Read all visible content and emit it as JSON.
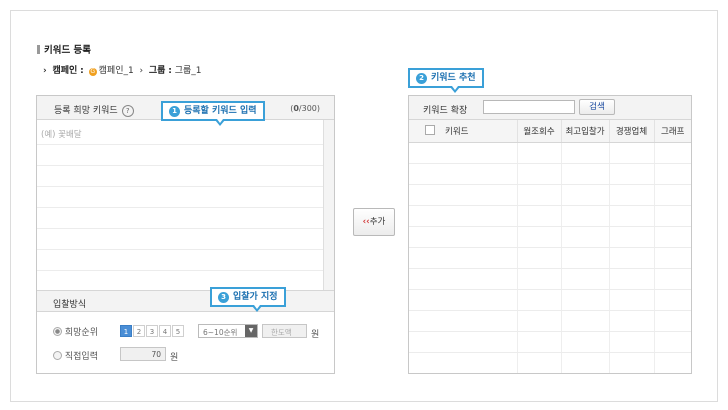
{
  "page": {
    "title": "키워드 등록"
  },
  "breadcrumb": {
    "campaign_label": "캠페인",
    "separator": ":",
    "campaign_name": "캠페인_1",
    "group_label": "그룹",
    "group_name": "그룹_1"
  },
  "callouts": {
    "one": {
      "num": "1",
      "text": "등록할 키워드 입력"
    },
    "two": {
      "num": "2",
      "text": "키워드 추천"
    },
    "three": {
      "num": "3",
      "text": "입찰가 지정"
    }
  },
  "left_panel": {
    "header_label": "등록 희망 키워드",
    "help_icon": "?",
    "count_current": "0",
    "count_max": "/300)",
    "count_open": "(",
    "textarea_placeholder": "(예) 꽃배달"
  },
  "bid": {
    "section_label": "입찰방식",
    "option_rank_label": "희망순위",
    "pages": [
      "1",
      "2",
      "3",
      "4",
      "5"
    ],
    "active_page": "1",
    "rank_select_value": "6~10순위",
    "limit_placeholder": "한도액",
    "unit_won": "원",
    "option_direct_label": "직접입력",
    "direct_value": "70",
    "selected_option": "희망순위"
  },
  "add_button": {
    "icon": "‹‹",
    "label": "추가"
  },
  "right_panel": {
    "expand_label": "키워드 확장",
    "search_button": "검색",
    "columns": [
      "키워드",
      "월조회수",
      "최고입찰가",
      "경쟁업체",
      "그래프"
    ]
  },
  "colors": {
    "accent": "#3aa0d8",
    "page_active": "#4a8ed6",
    "add_arrow": "#d03030"
  }
}
